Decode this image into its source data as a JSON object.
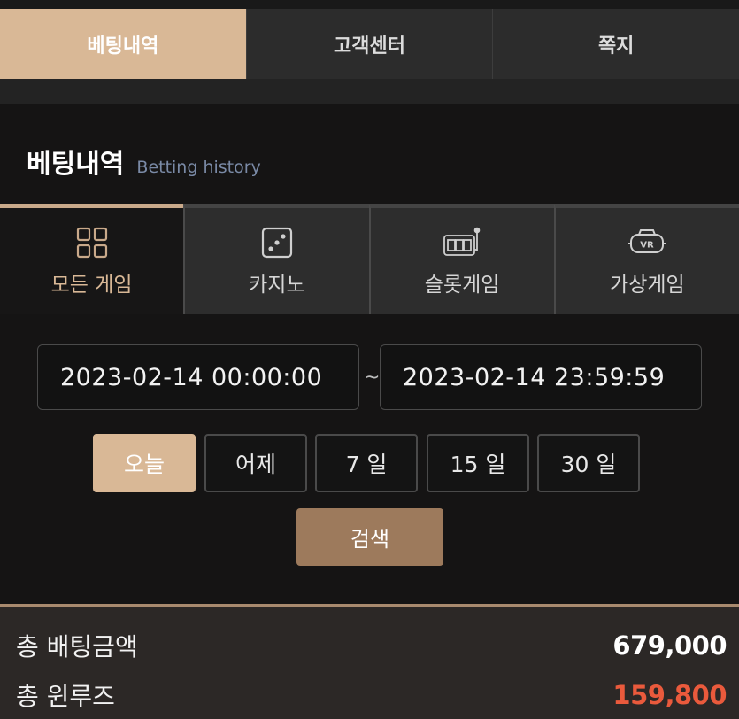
{
  "top_tabs": [
    {
      "label": "베팅내역",
      "active": true
    },
    {
      "label": "고객센터",
      "active": false
    },
    {
      "label": "쪽지",
      "active": false
    }
  ],
  "section": {
    "title_ko": "베팅내역",
    "title_en": "Betting history"
  },
  "game_tabs": [
    {
      "label": "모든 게임",
      "icon": "grid-icon",
      "active": true
    },
    {
      "label": "카지노",
      "icon": "dice-icon",
      "active": false
    },
    {
      "label": "슬롯게임",
      "icon": "slot-machine-icon",
      "active": false
    },
    {
      "label": "가상게임",
      "icon": "vr-headset-icon",
      "active": false
    }
  ],
  "date_range": {
    "start": "2023-02-14 00:00:00",
    "separator": "~",
    "end": "2023-02-14 23:59:59"
  },
  "quick_ranges": [
    {
      "label": "오늘",
      "active": true
    },
    {
      "label": "어제",
      "active": false
    },
    {
      "label": "7 일",
      "active": false
    },
    {
      "label": "15 일",
      "active": false
    },
    {
      "label": "30 일",
      "active": false
    }
  ],
  "search_label": "검색",
  "totals": {
    "bet_label": "총 배팅금액",
    "bet_value": "679,000",
    "winloss_label": "총 윈루즈",
    "winloss_value": "159,800"
  },
  "colors": {
    "accent": "#d9b896",
    "button": "#9d7a5c",
    "negative": "#ea5a3c"
  }
}
